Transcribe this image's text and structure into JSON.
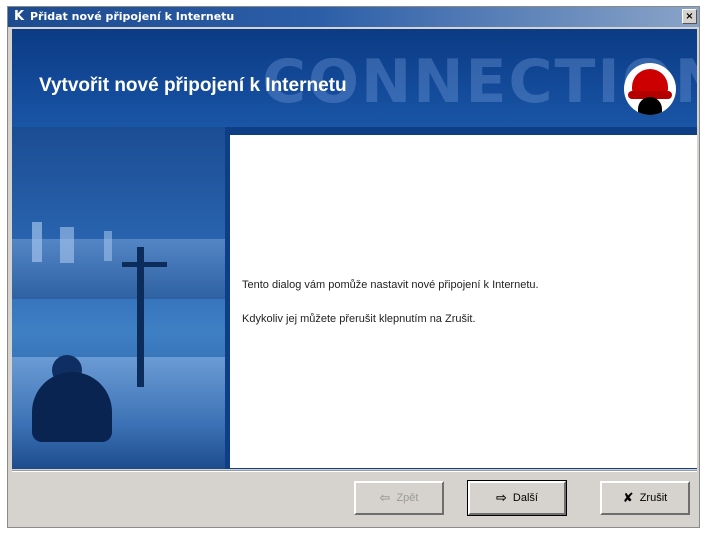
{
  "window": {
    "title": "Přidat nové připojení k Internetu",
    "close_glyph": "×"
  },
  "header": {
    "heading": "Vytvořit nové připojení k Internetu",
    "watermark": "CONNECTION",
    "logo_icon": "redhat-shadowman-icon"
  },
  "content": {
    "line1": "Tento dialog vám pomůže nastavit nové připojení k Internetu.",
    "line2": "Kdykoliv jej můžete přerušit klepnutím na Zrušit."
  },
  "buttons": {
    "back_label": "Zpět",
    "back_icon": "back-arrow-icon",
    "back_enabled": false,
    "next_label": "Další",
    "next_icon": "forward-arrow-icon",
    "cancel_label": "Zrušit",
    "cancel_icon": "x-icon"
  },
  "colors": {
    "banner": "#0e3f86",
    "titlebar": "#1d4b8f",
    "dialog_bg": "#d6d3ce"
  }
}
